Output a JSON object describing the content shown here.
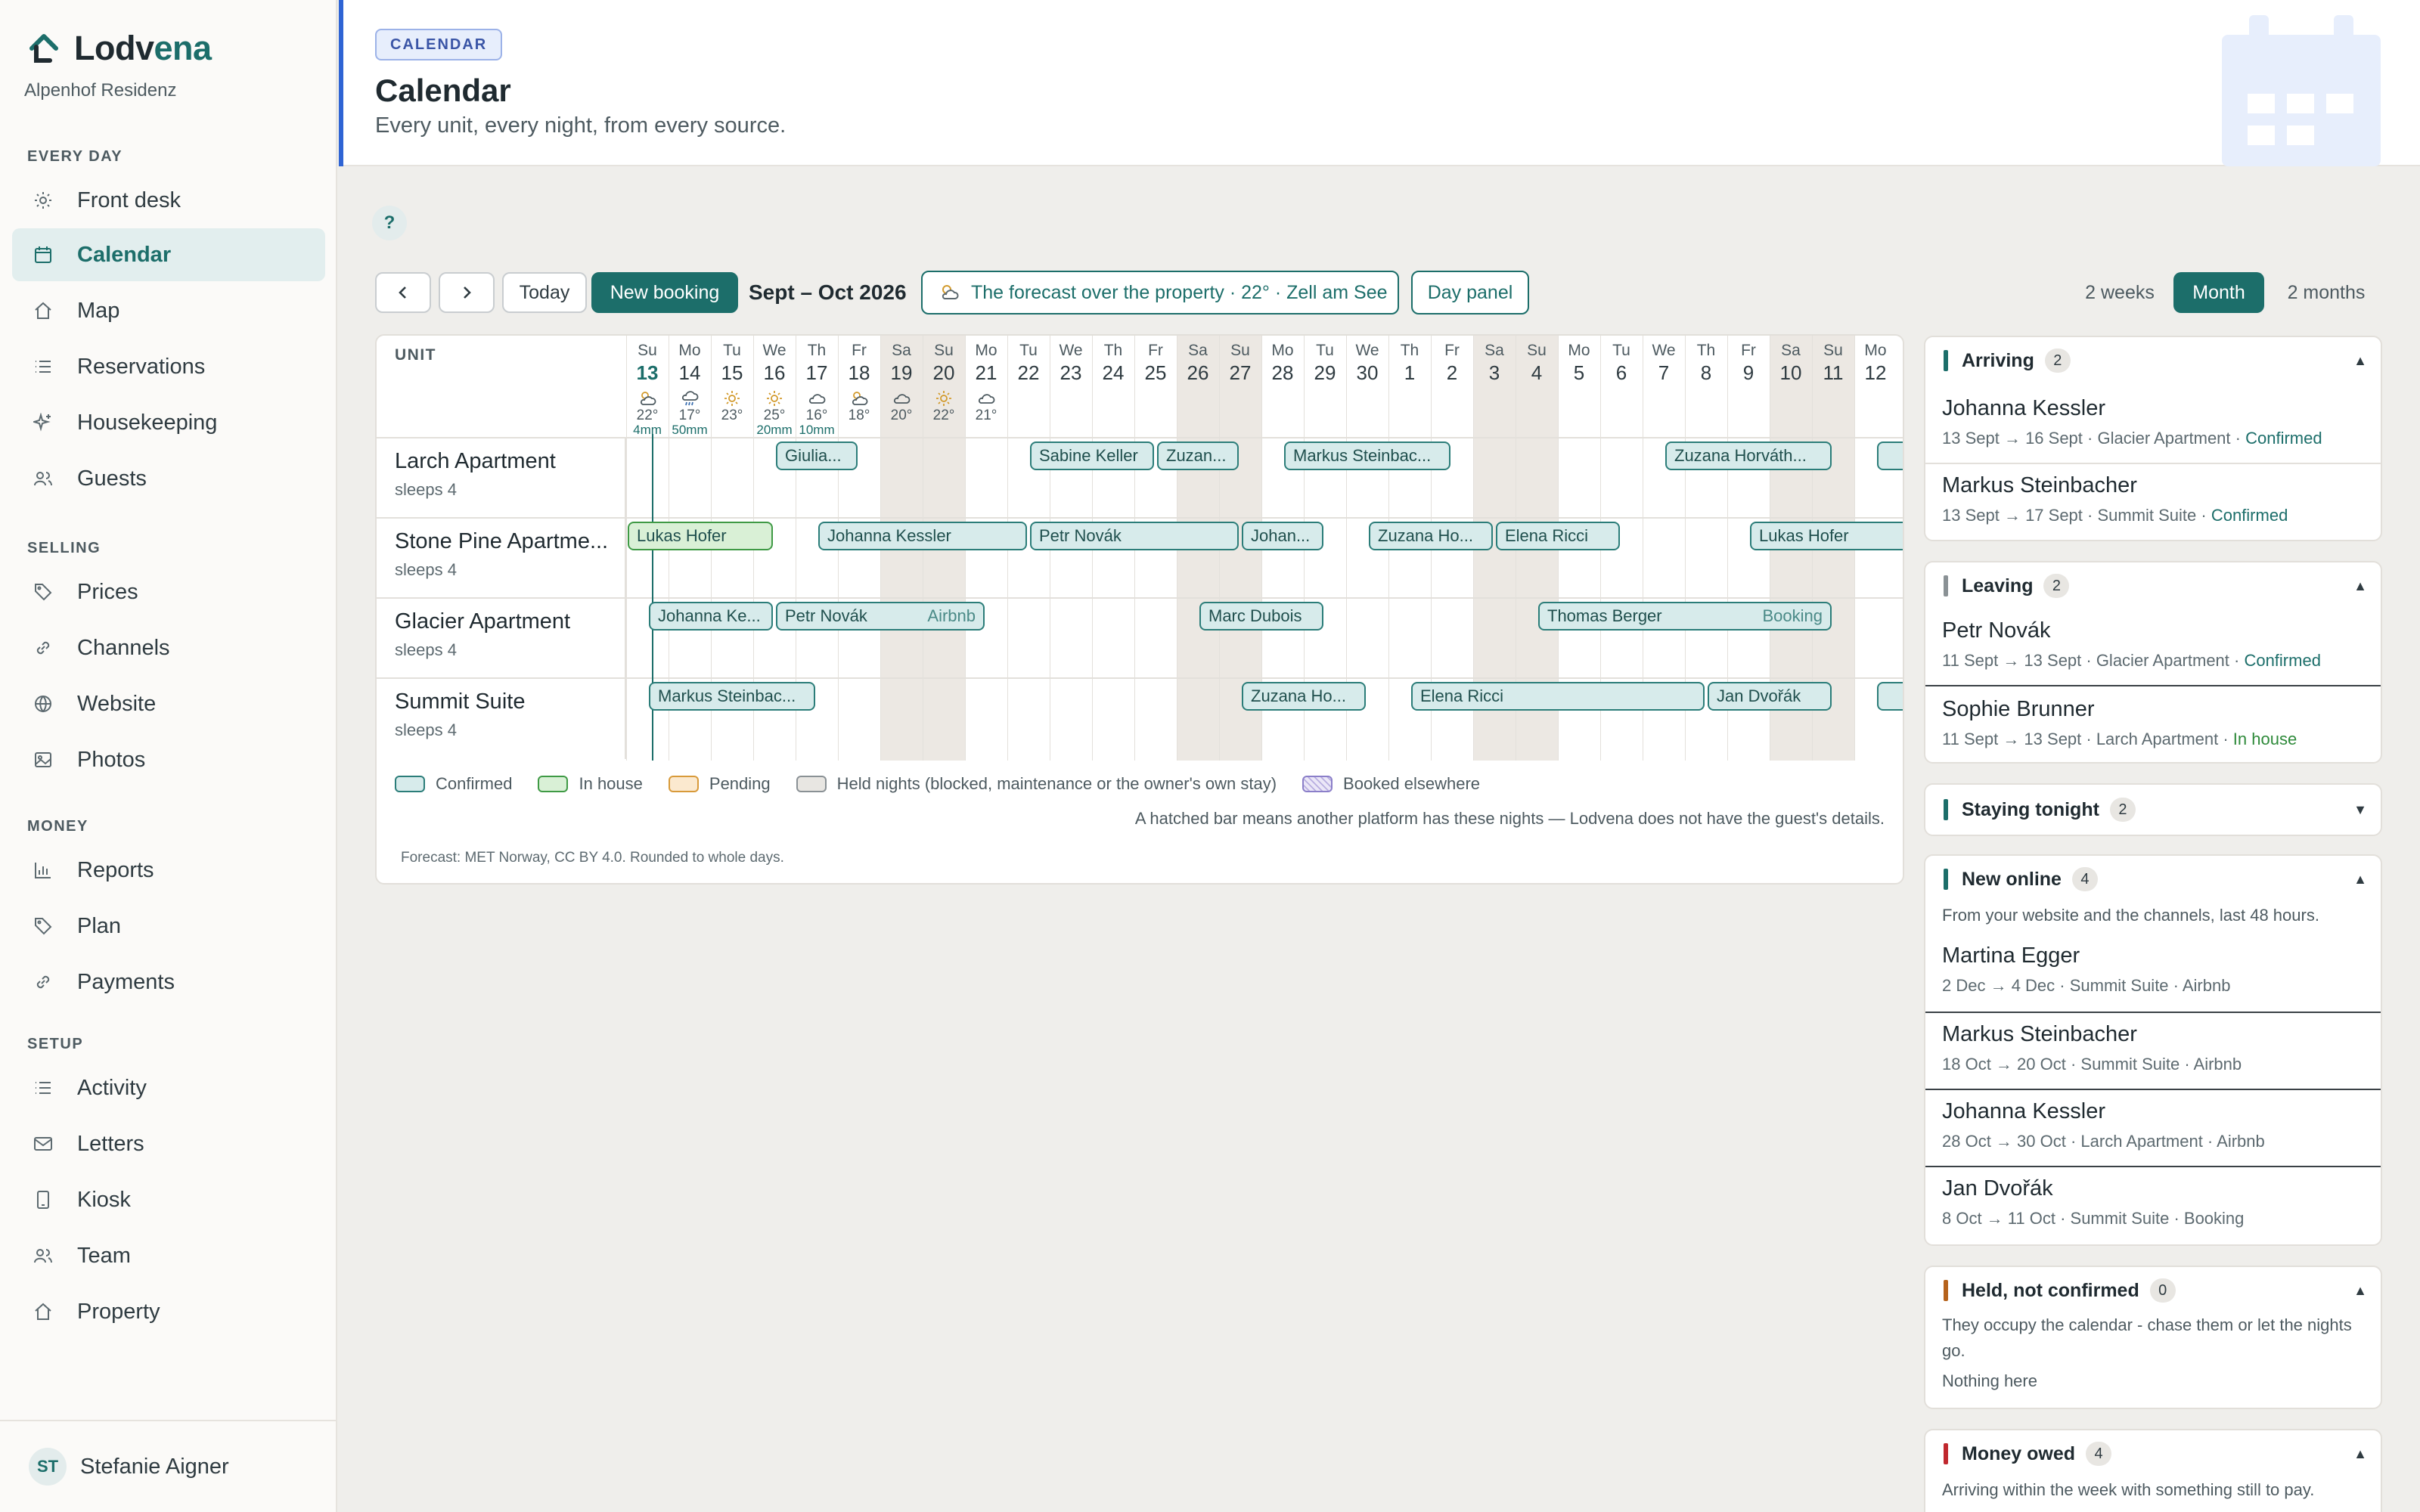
{
  "app": {
    "brand_prefix": "Lodv",
    "brand_accent": "ena",
    "property": "Alpenhof Residenz",
    "accent_color": "#1c6e6a"
  },
  "sidebar": {
    "sections": [
      {
        "label": "EVERY DAY"
      },
      {
        "label": "SELLING"
      },
      {
        "label": "MONEY"
      },
      {
        "label": "SETUP"
      }
    ],
    "items": [
      {
        "label": "Front desk",
        "icon": "sun-icon"
      },
      {
        "label": "Calendar",
        "icon": "calendar-icon",
        "active": true
      },
      {
        "label": "Map",
        "icon": "home-icon"
      },
      {
        "label": "Reservations",
        "icon": "list-icon"
      },
      {
        "label": "Housekeeping",
        "icon": "sparkle-icon"
      },
      {
        "label": "Guests",
        "icon": "users-icon"
      },
      {
        "label": "Prices",
        "icon": "tag-icon"
      },
      {
        "label": "Channels",
        "icon": "link-icon"
      },
      {
        "label": "Website",
        "icon": "globe-icon"
      },
      {
        "label": "Photos",
        "icon": "image-icon"
      },
      {
        "label": "Reports",
        "icon": "bar-chart-icon"
      },
      {
        "label": "Plan",
        "icon": "tag-icon"
      },
      {
        "label": "Payments",
        "icon": "link-icon"
      },
      {
        "label": "Activity",
        "icon": "list-icon"
      },
      {
        "label": "Letters",
        "icon": "mail-icon"
      },
      {
        "label": "Kiosk",
        "icon": "tablet-icon"
      },
      {
        "label": "Team",
        "icon": "users-icon"
      },
      {
        "label": "Property",
        "icon": "home-icon"
      }
    ],
    "user": {
      "initials": "ST",
      "name": "Stefanie Aigner"
    }
  },
  "header": {
    "badge": "CALENDAR",
    "title": "Calendar",
    "subtitle": "Every unit, every night, from every source."
  },
  "toolbar": {
    "help": "?",
    "today": "Today",
    "new_booking": "New booking",
    "range": "Sept – Oct 2026",
    "forecast": "The forecast over the property · 22° · Zell am See",
    "day_panel": "Day panel",
    "views": [
      "2 weeks",
      "Month",
      "2 months"
    ],
    "active_view": "Month"
  },
  "grid": {
    "unit_header": "UNIT",
    "days": [
      {
        "dw": "Su",
        "dn": "13",
        "wx": "partly-cloudy-icon",
        "t": "22°",
        "r": "4mm",
        "today": true
      },
      {
        "dw": "Mo",
        "dn": "14",
        "wx": "rain-icon",
        "t": "17°",
        "r": "50mm"
      },
      {
        "dw": "Tu",
        "dn": "15",
        "wx": "sun-icon",
        "t": "23°"
      },
      {
        "dw": "We",
        "dn": "16",
        "wx": "sun-icon",
        "t": "25°",
        "r": "20mm"
      },
      {
        "dw": "Th",
        "dn": "17",
        "wx": "cloud-icon",
        "t": "16°",
        "r": "10mm"
      },
      {
        "dw": "Fr",
        "dn": "18",
        "wx": "partly-cloudy-icon",
        "t": "18°"
      },
      {
        "dw": "Sa",
        "dn": "19",
        "wx": "cloud-icon",
        "t": "20°",
        "weekend": true
      },
      {
        "dw": "Su",
        "dn": "20",
        "wx": "sun-icon",
        "t": "22°",
        "weekend": true
      },
      {
        "dw": "Mo",
        "dn": "21",
        "wx": "cloud-icon",
        "t": "21°"
      },
      {
        "dw": "Tu",
        "dn": "22"
      },
      {
        "dw": "We",
        "dn": "23"
      },
      {
        "dw": "Th",
        "dn": "24"
      },
      {
        "dw": "Fr",
        "dn": "25"
      },
      {
        "dw": "Sa",
        "dn": "26",
        "weekend": true
      },
      {
        "dw": "Su",
        "dn": "27",
        "weekend": true
      },
      {
        "dw": "Mo",
        "dn": "28"
      },
      {
        "dw": "Tu",
        "dn": "29"
      },
      {
        "dw": "We",
        "dn": "30"
      },
      {
        "dw": "Th",
        "dn": "1"
      },
      {
        "dw": "Fr",
        "dn": "2"
      },
      {
        "dw": "Sa",
        "dn": "3",
        "weekend": true
      },
      {
        "dw": "Su",
        "dn": "4",
        "weekend": true
      },
      {
        "dw": "Mo",
        "dn": "5"
      },
      {
        "dw": "Tu",
        "dn": "6"
      },
      {
        "dw": "We",
        "dn": "7"
      },
      {
        "dw": "Th",
        "dn": "8"
      },
      {
        "dw": "Fr",
        "dn": "9"
      },
      {
        "dw": "Sa",
        "dn": "10",
        "weekend": true
      },
      {
        "dw": "Su",
        "dn": "11",
        "weekend": true
      },
      {
        "dw": "Mo",
        "dn": "12"
      }
    ],
    "units": [
      {
        "name": "Larch Apartment",
        "sleeps": "sleeps 4"
      },
      {
        "name": "Stone Pine Apartme...",
        "sleeps": "sleeps 4"
      },
      {
        "name": "Glacier Apartment",
        "sleeps": "sleeps 4"
      },
      {
        "name": "Summit Suite",
        "sleeps": "sleeps 4"
      }
    ],
    "bookings": [
      {
        "unit": 0,
        "start": 3.5,
        "end": 5.5,
        "label": "Giulia...",
        "status": "confirmed"
      },
      {
        "unit": 0,
        "start": 9.5,
        "end": 12.5,
        "label": "Sabine Keller",
        "status": "confirmed"
      },
      {
        "unit": 0,
        "start": 12.5,
        "end": 14.5,
        "label": "Zuzan...",
        "status": "confirmed"
      },
      {
        "unit": 0,
        "start": 15.5,
        "end": 19.5,
        "label": "Markus Steinbac...",
        "status": "confirmed"
      },
      {
        "unit": 0,
        "start": 24.5,
        "end": 28.5,
        "label": "Zuzana Horváth...",
        "status": "confirmed"
      },
      {
        "unit": 0,
        "start": 29.5,
        "end": 31,
        "label": "",
        "status": "confirmed"
      },
      {
        "unit": 1,
        "start": 0,
        "end": 3.5,
        "label": "Lukas Hofer",
        "status": "inhouse"
      },
      {
        "unit": 1,
        "start": 4.5,
        "end": 9.5,
        "label": "Johanna Kessler",
        "status": "confirmed"
      },
      {
        "unit": 1,
        "start": 9.5,
        "end": 14.5,
        "label": "Petr Novák",
        "status": "confirmed"
      },
      {
        "unit": 1,
        "start": 14.5,
        "end": 16.5,
        "label": "Johan...",
        "status": "confirmed"
      },
      {
        "unit": 1,
        "start": 17.5,
        "end": 20.5,
        "label": "Zuzana Ho...",
        "status": "confirmed"
      },
      {
        "unit": 1,
        "start": 20.5,
        "end": 23.5,
        "label": "Elena Ricci",
        "status": "confirmed"
      },
      {
        "unit": 1,
        "start": 26.5,
        "end": 31,
        "label": "Lukas Hofer",
        "status": "confirmed"
      },
      {
        "unit": 2,
        "start": 0.5,
        "end": 3.5,
        "label": "Johanna Ke...",
        "status": "confirmed"
      },
      {
        "unit": 2,
        "start": 3.5,
        "end": 8.5,
        "label": "Petr Novák",
        "src": "Airbnb",
        "status": "confirmed"
      },
      {
        "unit": 2,
        "start": 13.5,
        "end": 16.5,
        "label": "Marc Dubois",
        "status": "confirmed"
      },
      {
        "unit": 2,
        "start": 21.5,
        "end": 28.5,
        "label": "Thomas Berger",
        "src": "Booking",
        "status": "confirmed"
      },
      {
        "unit": 3,
        "start": 0.5,
        "end": 4.5,
        "label": "Markus Steinbac...",
        "status": "confirmed"
      },
      {
        "unit": 3,
        "start": 14.5,
        "end": 17.5,
        "label": "Zuzana Ho...",
        "status": "confirmed"
      },
      {
        "unit": 3,
        "start": 18.5,
        "end": 25.5,
        "label": "Elena Ricci",
        "status": "confirmed"
      },
      {
        "unit": 3,
        "start": 25.5,
        "end": 28.5,
        "label": "Jan Dvořák",
        "status": "confirmed"
      },
      {
        "unit": 3,
        "start": 29.5,
        "end": 31,
        "label": "",
        "status": "confirmed"
      }
    ],
    "legend": {
      "confirmed": "Confirmed",
      "inhouse": "In house",
      "pending": "Pending",
      "held": "Held nights  (blocked, maintenance or the owner's own stay)",
      "elsewhere": "Booked elsewhere"
    },
    "hatch_note": "A hatched bar means another platform has these nights — Lodvena does not have the guest's details.",
    "source_note": "Forecast: MET Norway, CC BY 4.0. Rounded to whole days.",
    "colors": {
      "confirmed": "#d7ebeb",
      "inhouse": "#d9f0d6",
      "pending": "#fbe9cf",
      "held": "#e8e6e2"
    }
  },
  "panels": {
    "arriving": {
      "title": "Arriving",
      "count": "2",
      "entries": [
        {
          "name": "Johanna Kessler",
          "detail": "13 Sept → 16 Sept  · Glacier Apartment  · ",
          "status": "Confirmed"
        },
        {
          "name": "Markus Steinbacher",
          "detail": "13 Sept → 17 Sept  · Summit Suite  · ",
          "status": "Confirmed"
        }
      ]
    },
    "leaving": {
      "title": "Leaving",
      "count": "2",
      "entries": [
        {
          "name": "Petr Novák",
          "detail": "11 Sept → 13 Sept  · Glacier Apartment  · ",
          "status": "Confirmed"
        },
        {
          "name": "Sophie Brunner",
          "detail": "11 Sept → 13 Sept  · Larch Apartment  · ",
          "status": "In house"
        }
      ]
    },
    "staying": {
      "title": "Staying tonight",
      "count": "2"
    },
    "new_online": {
      "title": "New online",
      "count": "4",
      "note": "From your website and the channels, last 48 hours.",
      "entries": [
        {
          "name": "Martina Egger",
          "detail": "2 Dec → 4 Dec  · Summit Suite  · Airbnb"
        },
        {
          "name": "Markus Steinbacher",
          "detail": "18 Oct → 20 Oct  · Summit Suite  · Airbnb"
        },
        {
          "name": "Johanna Kessler",
          "detail": "28 Oct → 30 Oct  · Larch Apartment  · Airbnb"
        },
        {
          "name": "Jan Dvořák",
          "detail": "8 Oct → 11 Oct  · Summit Suite  · Booking"
        }
      ]
    },
    "held": {
      "title": "Held, not confirmed",
      "count": "0",
      "note": "They occupy the calendar - chase them or let the nights go.",
      "empty": "Nothing here"
    },
    "owed": {
      "title": "Money owed",
      "count": "4",
      "note": "Arriving within the week with something still to pay."
    }
  }
}
